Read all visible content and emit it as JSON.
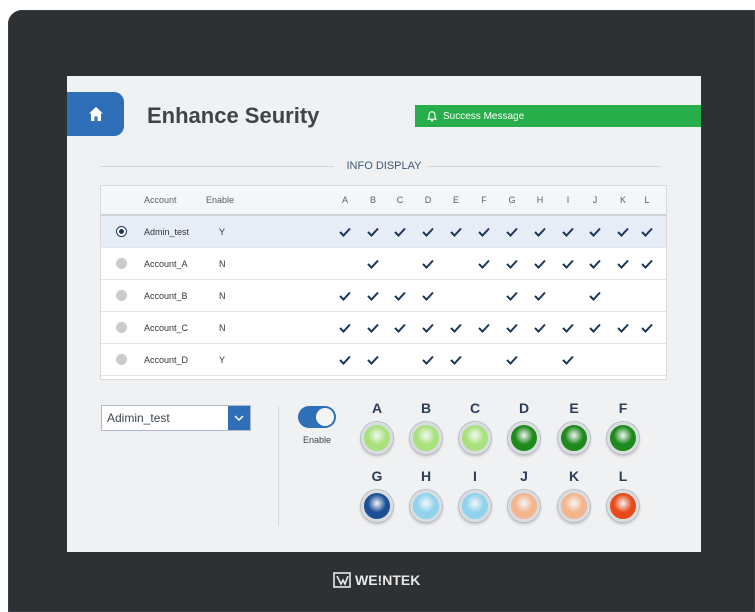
{
  "header": {
    "title": "Enhance Seurity",
    "success_message": "Success Message"
  },
  "info_display": {
    "legend": "INFO DISPLAY",
    "columns": {
      "account": "Account",
      "enable": "Enable",
      "letters": [
        "A",
        "B",
        "C",
        "D",
        "E",
        "F",
        "G",
        "H",
        "I",
        "J",
        "K",
        "L"
      ]
    },
    "rows": [
      {
        "account": "Admin_test",
        "enable": "Y",
        "selected": true,
        "checks": [
          1,
          1,
          1,
          1,
          1,
          1,
          1,
          1,
          1,
          1,
          1,
          1
        ]
      },
      {
        "account": "Account_A",
        "enable": "N",
        "selected": false,
        "checks": [
          0,
          1,
          0,
          1,
          0,
          1,
          1,
          1,
          1,
          1,
          1,
          1
        ]
      },
      {
        "account": "Account_B",
        "enable": "N",
        "selected": false,
        "checks": [
          1,
          1,
          1,
          1,
          0,
          0,
          1,
          1,
          0,
          1,
          0,
          0
        ]
      },
      {
        "account": "Account_C",
        "enable": "N",
        "selected": false,
        "checks": [
          1,
          1,
          1,
          1,
          1,
          1,
          1,
          1,
          1,
          1,
          1,
          1
        ]
      },
      {
        "account": "Account_D",
        "enable": "Y",
        "selected": false,
        "checks": [
          1,
          1,
          0,
          1,
          1,
          0,
          1,
          0,
          1,
          0,
          0,
          0
        ]
      }
    ]
  },
  "controls": {
    "dropdown_value": "Adimin_test",
    "toggle_label": "Enable",
    "toggle_on": true
  },
  "lamps": [
    {
      "label": "A",
      "color": "#a9e27c",
      "state": "light-green"
    },
    {
      "label": "B",
      "color": "#a9e27c",
      "state": "light-green"
    },
    {
      "label": "C",
      "color": "#a9e27c",
      "state": "light-green"
    },
    {
      "label": "D",
      "color": "#1f8a1c",
      "state": "dark-green"
    },
    {
      "label": "E",
      "color": "#1f8a1c",
      "state": "dark-green"
    },
    {
      "label": "F",
      "color": "#1f8a1c",
      "state": "dark-green"
    },
    {
      "label": "G",
      "color": "#1b4f96",
      "state": "dark-blue"
    },
    {
      "label": "H",
      "color": "#8fd3ec",
      "state": "light-blue"
    },
    {
      "label": "I",
      "color": "#8fd3ec",
      "state": "light-blue"
    },
    {
      "label": "J",
      "color": "#f2b58c",
      "state": "light-orange"
    },
    {
      "label": "K",
      "color": "#f2b58c",
      "state": "light-orange"
    },
    {
      "label": "L",
      "color": "#e84a1a",
      "state": "red"
    }
  ],
  "brand": "WE!NTEK",
  "colors": {
    "accent": "#2f6fb7",
    "success": "#27ae4a",
    "check": "#1d3557",
    "bezel": "#2e3134"
  }
}
